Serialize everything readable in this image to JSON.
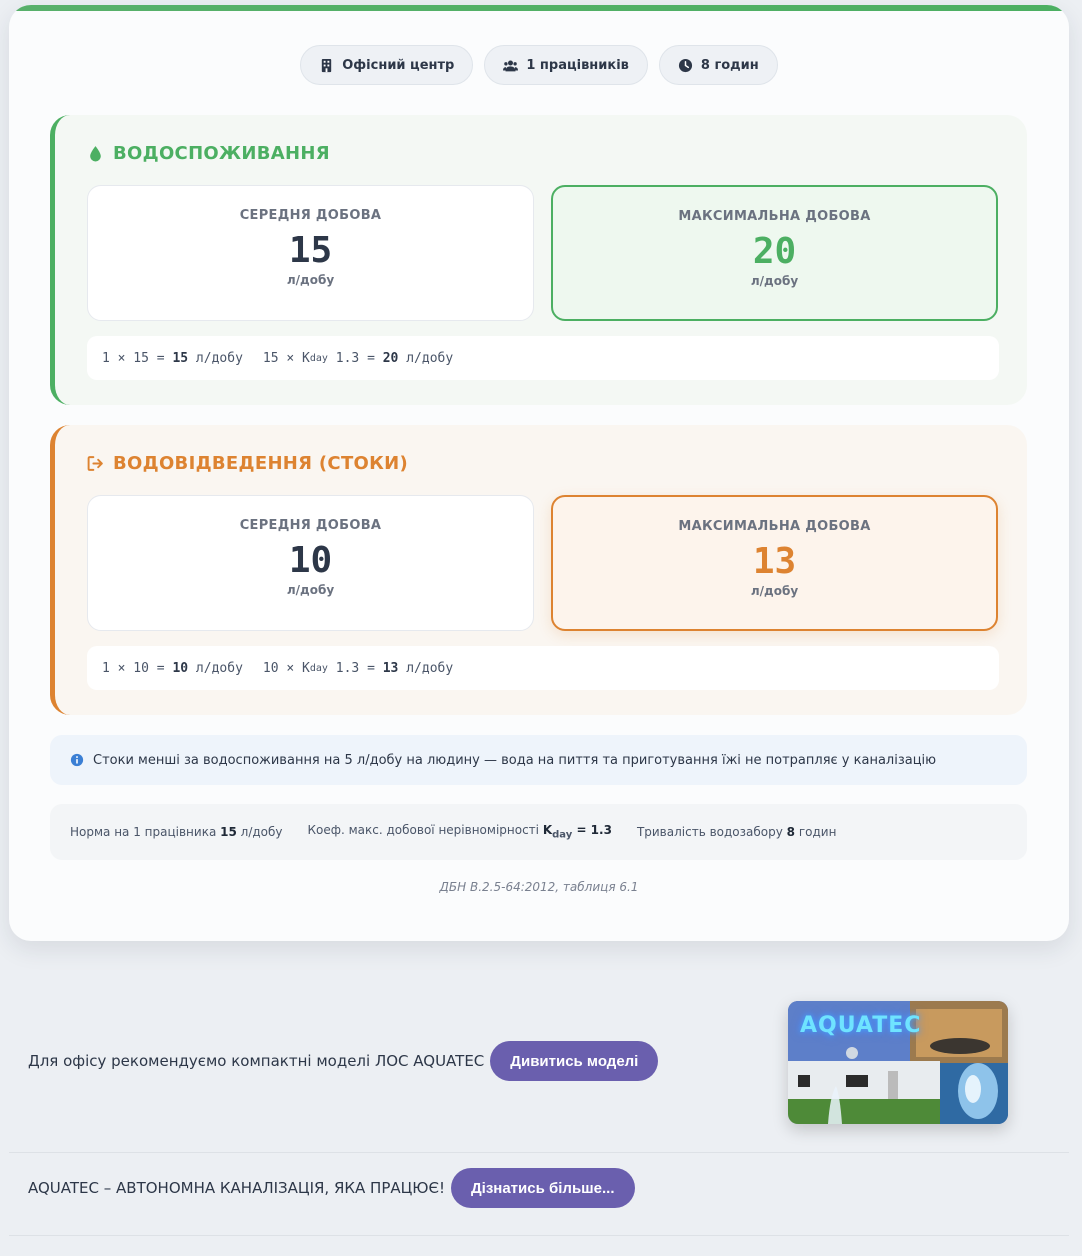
{
  "chips": [
    {
      "icon": "building-icon",
      "label": "Офісний центр"
    },
    {
      "icon": "users-icon",
      "label": "1 працівників"
    },
    {
      "icon": "clock-icon",
      "label": "8 годин"
    }
  ],
  "water": {
    "title": "ВОДОСПОЖИВАННЯ",
    "avg_label": "СЕРЕДНЯ ДОБОВА",
    "avg_value": "15",
    "avg_unit": "л/добу",
    "max_label": "МАКСИМАЛЬНА ДОБОВА",
    "max_value": "20",
    "max_unit": "л/добу",
    "formula": {
      "f1_a": "1 × 15 = ",
      "f1_b": "15",
      "f1_c": " л/добу",
      "f2_a": "15 × K",
      "f2_sub": "day",
      "f2_b": " 1.3 = ",
      "f2_c": "20",
      "f2_d": " л/добу"
    },
    "accent": "#4caf62"
  },
  "sewer": {
    "title": "ВОДОВІДВЕДЕННЯ (СТОКИ)",
    "avg_label": "СЕРЕДНЯ ДОБОВА",
    "avg_value": "10",
    "avg_unit": "л/добу",
    "max_label": "МАКСИМАЛЬНА ДОБОВА",
    "max_value": "13",
    "max_unit": "л/добу",
    "formula": {
      "f1_a": "1 × 10 = ",
      "f1_b": "10",
      "f1_c": " л/добу",
      "f2_a": "10 × K",
      "f2_sub": "day",
      "f2_b": " 1.3 = ",
      "f2_c": "13",
      "f2_d": " л/добу"
    },
    "accent": "#dd8331"
  },
  "info": {
    "text": "Стоки менші за водоспоживання на 5 л/добу на людину — вода на пиття та приготування їжі не потрапляє у каналізацію"
  },
  "norms": {
    "n1_a": "Норма на 1 працівника ",
    "n1_b": "15",
    "n1_c": " л/добу",
    "n2_a": "Коеф. макс. добової нерівномірності ",
    "n2_k": "K",
    "n2_sub": "day",
    "n2_b": " = 1.3",
    "n3_a": "Тривалість водозабору ",
    "n3_b": "8",
    "n3_c": " годин"
  },
  "source": "ДБН В.2.5-64:2012, таблиця 6.1",
  "promo1": {
    "text": "Для офісу рекомендуємо компактні моделі ЛОС AQUATEC",
    "button": "Дивитись моделі"
  },
  "promo2": {
    "text": "AQUATEC – АВТОНОМНА КАНАЛІЗАЦІЯ, ЯКА ПРАЦЮЄ!",
    "button": "Дізнатись більше..."
  },
  "promo_image": {
    "logo": "AQUATEC"
  }
}
